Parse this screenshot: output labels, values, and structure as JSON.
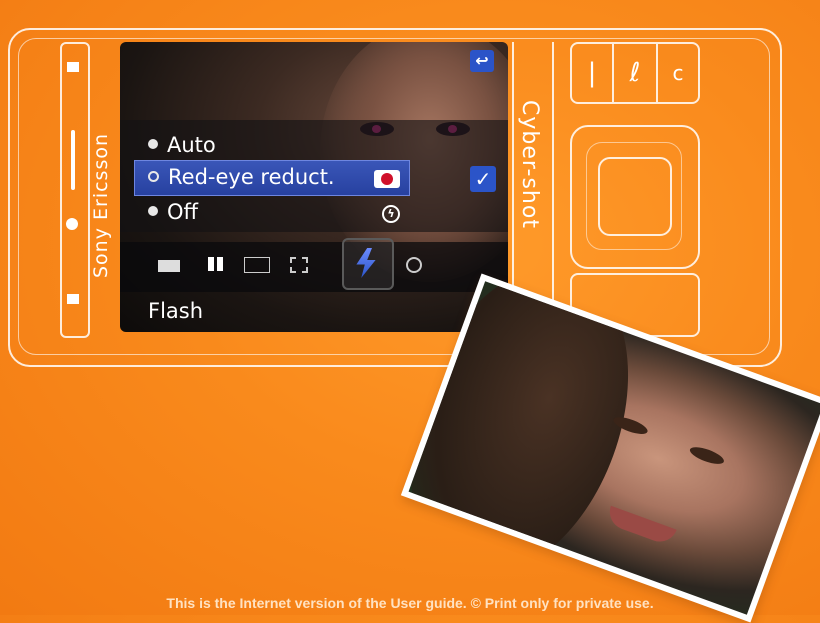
{
  "phone": {
    "brand": "Sony Ericsson",
    "model_label": "Cyber-shot"
  },
  "screen": {
    "menu": [
      {
        "label": "Auto",
        "selected": false
      },
      {
        "label": "Red-eye reduct.",
        "selected": true
      },
      {
        "label": "Off",
        "selected": false
      }
    ],
    "toolbar_icons": [
      "shoot-mode-icon",
      "scenes-icon",
      "picture-size-5mp-icon",
      "focus-icon",
      "flash-icon",
      "self-timer-icon"
    ],
    "bottom_label": "Flash",
    "colors": {
      "selection": "#2741a0",
      "accent": "#2b54c8",
      "background": "#f98a1c"
    }
  },
  "footer": {
    "text": "This is the Internet version of the User guide. © Print only for private use."
  }
}
